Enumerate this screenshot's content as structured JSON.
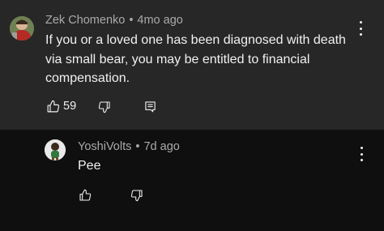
{
  "comment": {
    "author": "Zek Chomenko",
    "separator": "•",
    "time": "4mo ago",
    "text": "If you or a loved one has been diagnosed with death via small bear, you may be entitled to financial compensation.",
    "like_count": "59",
    "icons": [
      "thumbs-up-icon",
      "thumbs-down-icon",
      "reply-icon",
      "more-options-icon"
    ]
  },
  "reply": {
    "author": "YoshiVolts",
    "separator": "•",
    "time": "7d ago",
    "text": "Pee",
    "icons": [
      "thumbs-up-icon",
      "thumbs-down-icon",
      "more-options-icon"
    ]
  },
  "colors": {
    "comment_background": "#272727",
    "page_background": "#0f0f0f",
    "primary_text": "#f1f1f1",
    "secondary_text": "#aaaaaa"
  }
}
